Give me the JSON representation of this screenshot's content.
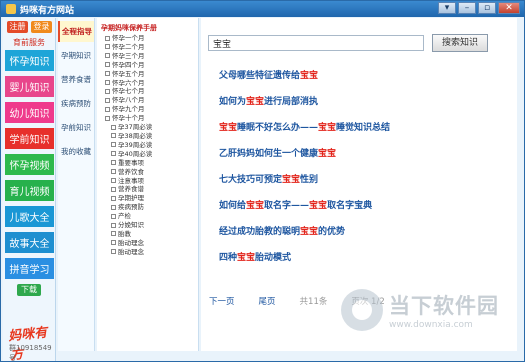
{
  "window": {
    "title": "妈咪有方网站",
    "controls": [
      "▾",
      "–",
      "▫",
      "✕"
    ]
  },
  "leftbar": {
    "register_label": "注册",
    "login_label": "登录",
    "parent_tag": "育前服务",
    "categories": [
      {
        "label": "怀孕知识",
        "color": "#1ea5d8"
      },
      {
        "label": "婴儿知识",
        "color": "#e8468b"
      },
      {
        "label": "幼儿知识",
        "color": "#ef3a8c"
      },
      {
        "label": "学前知识",
        "color": "#e7302b"
      },
      {
        "label": "怀孕视频",
        "color": "#2eb94c"
      },
      {
        "label": "育儿视频",
        "color": "#27b14c"
      },
      {
        "label": "儿歌大全",
        "color": "#1a97d5"
      },
      {
        "label": "故事大全",
        "color": "#1e8fd0"
      },
      {
        "label": "拼音学习",
        "color": "#2b8fe2"
      }
    ],
    "bottom_button": "下载",
    "logo_text": "妈咪有方",
    "qq_text": "群10918549号"
  },
  "secondnav": {
    "items": [
      "全程指导",
      "孕期知识",
      "营养食谱",
      "疾病预防",
      "孕前知识",
      "我的收藏"
    ]
  },
  "tree": {
    "title": "孕期妈咪保养手册",
    "items": [
      {
        "label": "怀孕一个月",
        "level": 1
      },
      {
        "label": "怀孕二个月",
        "level": 1
      },
      {
        "label": "怀孕三个月",
        "level": 1
      },
      {
        "label": "怀孕四个月",
        "level": 1
      },
      {
        "label": "怀孕五个月",
        "level": 1
      },
      {
        "label": "怀孕六个月",
        "level": 1
      },
      {
        "label": "怀孕七个月",
        "level": 1
      },
      {
        "label": "怀孕八个月",
        "level": 1
      },
      {
        "label": "怀孕九个月",
        "level": 1
      },
      {
        "label": "怀孕十个月",
        "level": 1
      },
      {
        "label": "孕37周必读",
        "level": 2
      },
      {
        "label": "孕38周必读",
        "level": 2
      },
      {
        "label": "孕39周必读",
        "level": 2
      },
      {
        "label": "孕40周必读",
        "level": 2
      },
      {
        "label": "重要事项",
        "level": 2
      },
      {
        "label": "营养饮食",
        "level": 2
      },
      {
        "label": "注意事项",
        "level": 2
      },
      {
        "label": "营养食谱",
        "level": 2
      },
      {
        "label": "孕期护理",
        "level": 2
      },
      {
        "label": "疾病预防",
        "level": 2
      },
      {
        "label": "产检",
        "level": 2
      },
      {
        "label": "分娩知识",
        "level": 2
      },
      {
        "label": "胎教",
        "level": 2
      },
      {
        "label": "胎动理念",
        "level": 2
      },
      {
        "label": "胎动理念",
        "level": 2
      }
    ]
  },
  "search": {
    "value": "宝宝",
    "button_label": "搜索知识"
  },
  "articles": [
    {
      "before": "父母哪些特征遗传给",
      "highlight": "宝宝",
      "after": "",
      "before2": "",
      "highlight2": "",
      "after2": ""
    },
    {
      "before": "如何为",
      "highlight": "宝宝",
      "after": "进行局部消执",
      "before2": "",
      "highlight2": "",
      "after2": ""
    },
    {
      "before": "",
      "highlight": "宝宝",
      "after": "睡眠不好怎么办——",
      "before2": "",
      "highlight2": "宝宝",
      "after2": "睡觉知识总结"
    },
    {
      "before": "乙肝妈妈如何生一个健康",
      "highlight": "宝宝",
      "after": "",
      "before2": "",
      "highlight2": "",
      "after2": ""
    },
    {
      "before": "七大技巧可预定",
      "highlight": "宝宝",
      "after": "性别",
      "before2": "",
      "highlight2": "",
      "after2": ""
    },
    {
      "before": "如何给",
      "highlight": "宝宝",
      "after": "取名字——",
      "before2": "",
      "highlight2": "宝宝",
      "after2": "取名字宝典"
    },
    {
      "before": "经过成功胎教的聪明",
      "highlight": "宝宝",
      "after": "的优势",
      "before2": "",
      "highlight2": "",
      "after2": ""
    },
    {
      "before": "四种",
      "highlight": "宝宝",
      "after": "胎动模式",
      "before2": "",
      "highlight2": "",
      "after2": ""
    }
  ],
  "pager": {
    "next": "下一页",
    "last": "尾页",
    "total": "共11条",
    "page": "页次 1/2"
  },
  "watermark": {
    "title": "当下软件园",
    "url": "www.downxia.com"
  }
}
